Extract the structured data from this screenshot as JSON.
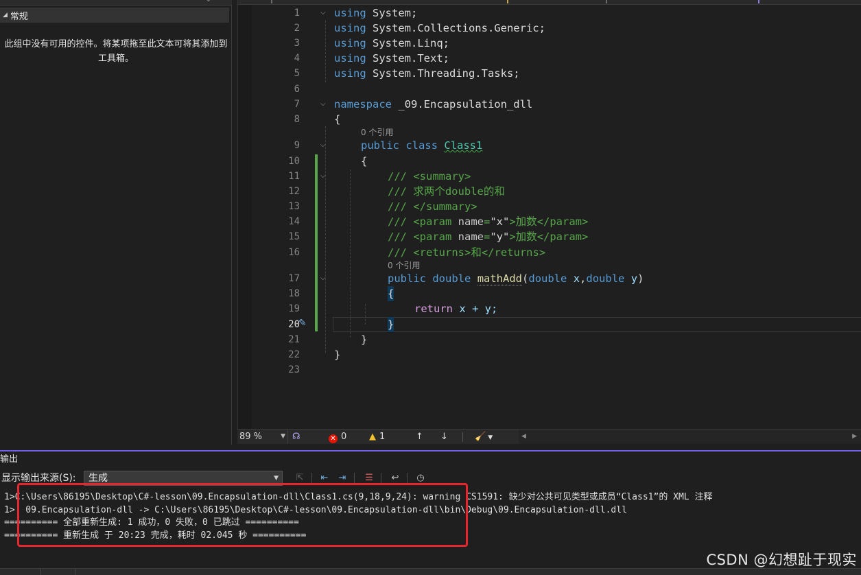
{
  "toolbox": {
    "group_label": "常规",
    "empty_message": "此组中没有可用的控件。将某项拖至此文本可将其添加到工具箱。"
  },
  "editor": {
    "lines": [
      {
        "n": "1"
      },
      {
        "n": "2"
      },
      {
        "n": "3"
      },
      {
        "n": "4"
      },
      {
        "n": "5"
      },
      {
        "n": "6"
      },
      {
        "n": "7"
      },
      {
        "n": "8"
      },
      {
        "n": "9"
      },
      {
        "n": "10"
      },
      {
        "n": "11"
      },
      {
        "n": "12"
      },
      {
        "n": "13"
      },
      {
        "n": "14"
      },
      {
        "n": "15"
      },
      {
        "n": "16"
      },
      {
        "n": "17"
      },
      {
        "n": "18"
      },
      {
        "n": "19"
      },
      {
        "n": "20"
      },
      {
        "n": "21"
      },
      {
        "n": "22"
      },
      {
        "n": "23"
      }
    ],
    "code": {
      "kw_using": "using",
      "ns1": " System;",
      "ns2": " System.Collections.Generic;",
      "ns3": " System.Linq;",
      "ns4": " System.Text;",
      "ns5": " System.Threading.Tasks;",
      "kw_namespace": "namespace",
      "namespace_name": " _09.Encapsulation_dll",
      "open_brace": "{",
      "close_brace": "}",
      "kw_public": "public",
      "kw_class": "class",
      "class_name": "Class1",
      "doc_prefix": "/// ",
      "summary_open": "<summary>",
      "summary_text": "求两个double的和",
      "summary_close": "</summary>",
      "param_open": "<param ",
      "param_attr": "name",
      "eq": "=",
      "param_x": "\"x\"",
      "param_y": "\"y\"",
      "gt": ">",
      "param_desc": "加数",
      "param_close": "</param>",
      "returns_open": "<returns>",
      "returns_text": "和",
      "returns_close": "</returns>",
      "kw_double": "double",
      "method_name": "mathAdd",
      "lparen": "(",
      "rparen": ")",
      "comma": ",",
      "p_x": "x",
      "p_y": "y",
      "kw_return": "return",
      "return_expr": " x + y;"
    },
    "codelens_class": "0 个引用",
    "codelens_method": "0 个引用"
  },
  "editor_status": {
    "zoom": "89 %",
    "errors": "0",
    "warnings": "1"
  },
  "output": {
    "title": "输出",
    "source_label": "显示输出来源(S):",
    "source_value": "生成",
    "lines": [
      "1>C:\\Users\\86195\\Desktop\\C#-lesson\\09.Encapsulation-dll\\Class1.cs(9,18,9,24): warning CS1591: 缺少对公共可见类型或成员“Class1”的 XML 注释",
      "1>  09.Encapsulation-dll -> C:\\Users\\86195\\Desktop\\C#-lesson\\09.Encapsulation-dll\\bin\\Debug\\09.Encapsulation-dll.dll",
      "========== 全部重新生成: 1 成功，0 失败，0 已跳过 ==========",
      "========== 重新生成 于 20:23 完成，耗时 02.045 秒 =========="
    ]
  },
  "watermark": "CSDN @幻想趾于现实",
  "colors": {
    "background": "#1f1f1f",
    "keyword": "#569cd6",
    "class": "#4ec9b0",
    "method": "#dcdcaa",
    "comment": "#57a64a",
    "accent": "#7160e8",
    "annotation": "#e8262e"
  }
}
